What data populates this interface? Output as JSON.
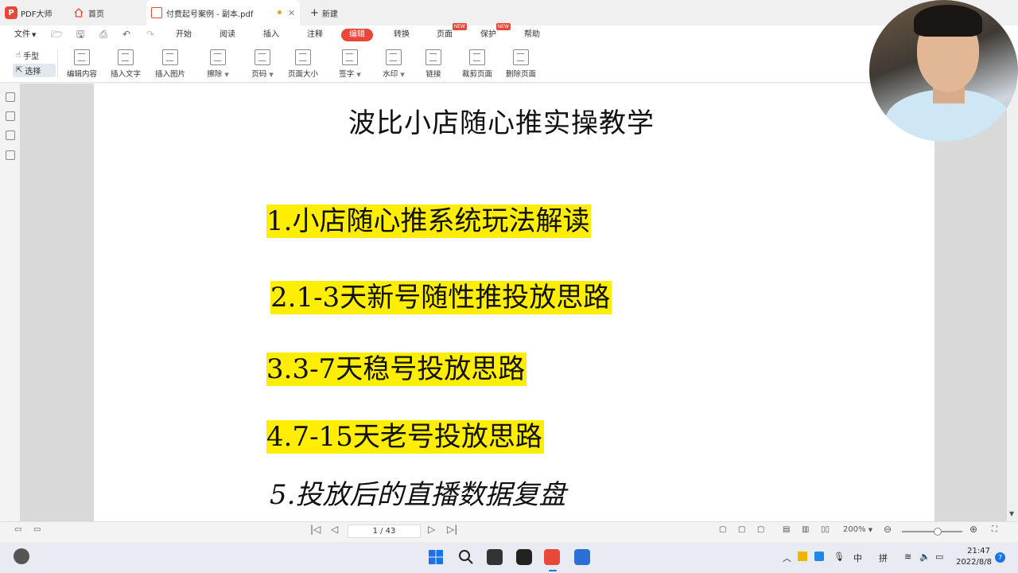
{
  "app": {
    "logo_text": "PDF大师",
    "tabs": [
      {
        "label": "首页"
      },
      {
        "label": "付费起号案例 - 副本.pdf"
      }
    ],
    "new_tab_label": "新建"
  },
  "menubar": {
    "file_label": "文件",
    "items": [
      {
        "label": "开始"
      },
      {
        "label": "阅读"
      },
      {
        "label": "插入"
      },
      {
        "label": "注释"
      },
      {
        "label": "编辑"
      },
      {
        "label": "转换"
      },
      {
        "label": "页面"
      },
      {
        "label": "保护"
      },
      {
        "label": "帮助"
      }
    ],
    "new_badge": "NEW"
  },
  "toolbar": {
    "hand_label": "手型",
    "select_label": "选择",
    "tools": [
      {
        "label": "编辑内容",
        "icon": "edit-content-icon"
      },
      {
        "label": "插入文字",
        "icon": "insert-text-icon"
      },
      {
        "label": "插入图片",
        "icon": "insert-image-icon"
      },
      {
        "label": "擦除",
        "icon": "eraser-icon"
      },
      {
        "label": "页码",
        "icon": "page-number-icon"
      },
      {
        "label": "页面大小",
        "icon": "page-size-icon"
      },
      {
        "label": "签字",
        "icon": "signature-icon"
      },
      {
        "label": "水印",
        "icon": "watermark-icon"
      },
      {
        "label": "链接",
        "icon": "link-icon"
      },
      {
        "label": "裁剪页面",
        "icon": "crop-icon"
      },
      {
        "label": "删除页面",
        "icon": "delete-page-icon"
      }
    ]
  },
  "document": {
    "title": "波比小店随心推实操教学",
    "items": [
      "1.小店随心推系统玩法解读",
      "2.1-3天新号随性推投放思路",
      "3.3-7天稳号投放思路",
      "4.7-15天老号投放思路",
      "5.投放后的直播数据复盘"
    ]
  },
  "statusbar": {
    "page_indicator": "1 / 43",
    "zoom": "200%"
  },
  "taskbar": {
    "ime_lang": "中",
    "ime_mode": "拼",
    "time": "21:47",
    "date": "2022/8/8",
    "notification_count": "7"
  },
  "colors": {
    "accent": "#e8473a",
    "highlight": "#ffee00"
  }
}
